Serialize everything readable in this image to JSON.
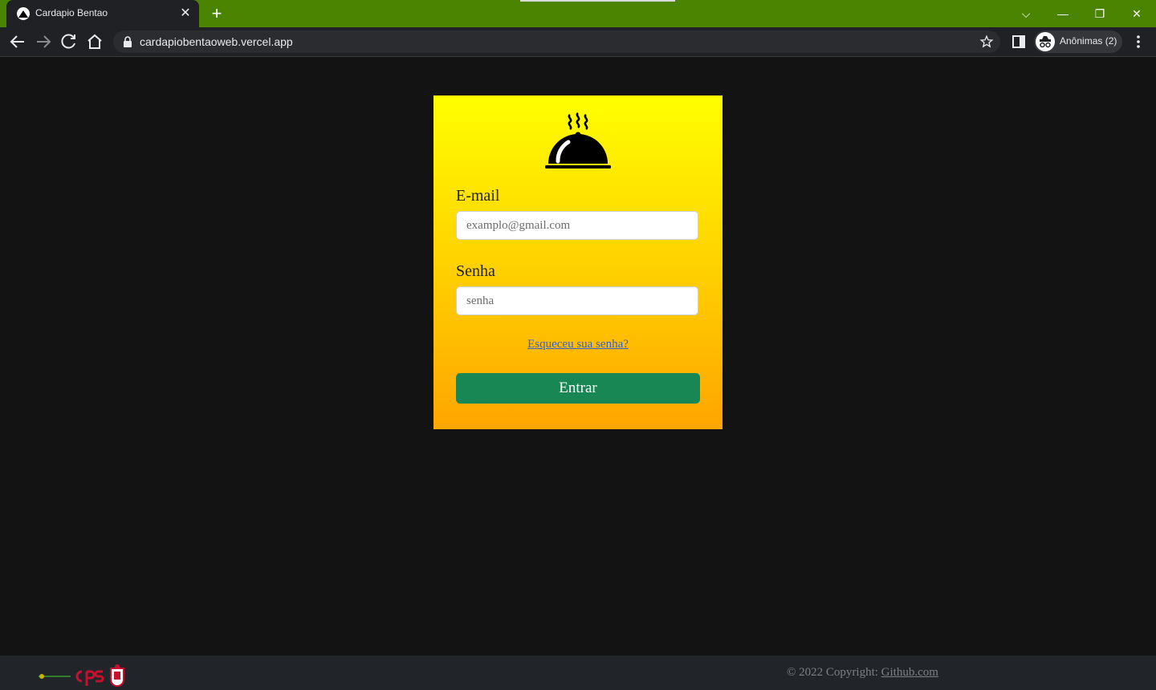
{
  "browser": {
    "tab_title": "Cardapio Bentao",
    "new_tab_symbol": "+",
    "close_symbol": "✕",
    "url": "cardapiobentaoweb.vercel.app",
    "profile_label": "Anônimas (2)",
    "tabbar_color": "#4a8400",
    "window_buttons": {
      "tab_search": "⌵",
      "minimize": "—",
      "restore": "❐",
      "close": "✕"
    }
  },
  "login": {
    "logo_icon": "cloche-icon",
    "email_label": "E-mail",
    "email_placeholder": "examplo@gmail.com",
    "password_label": "Senha",
    "password_placeholder": "senha",
    "forgot_link": "Esqueceu sua senha?",
    "submit_label": "Entrar",
    "gradient_top": "#ffff00",
    "gradient_bottom": "#ffa500",
    "button_color": "#198754"
  },
  "footer": {
    "copyright_prefix": "© 2022 Copyright: ",
    "copyright_link": "Github.com"
  }
}
